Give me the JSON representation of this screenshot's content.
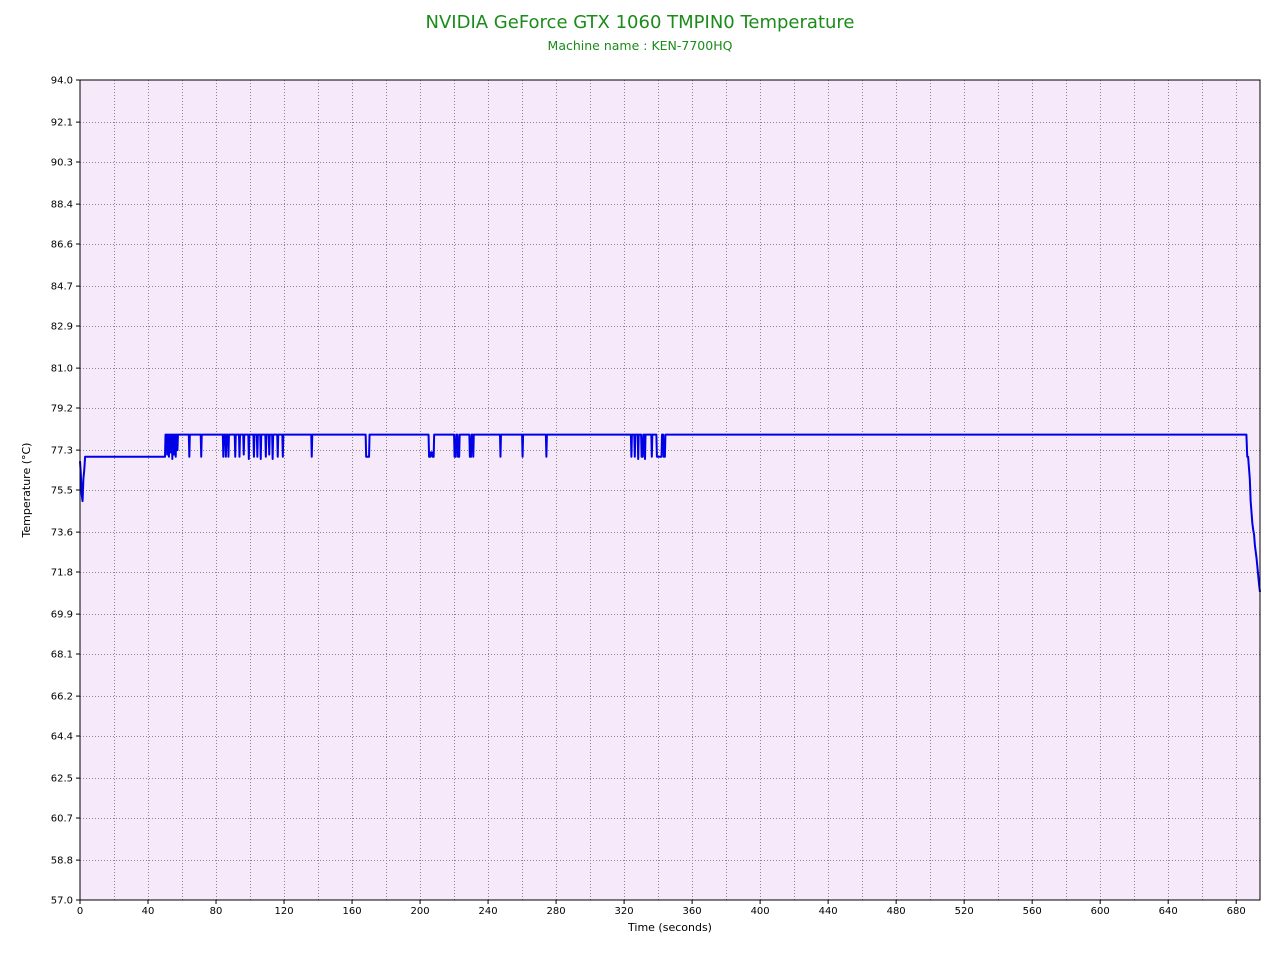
{
  "colors": {
    "title": "#1a8c1a",
    "plot_background": "#f5e9fa",
    "grid": "#888888",
    "series": "#0000e6",
    "frame": "#000000"
  },
  "chart_data": {
    "type": "line",
    "title": "NVIDIA GeForce GTX 1060 TMPIN0 Temperature",
    "subtitle": "Machine name : KEN-7700HQ",
    "xlabel": "Time (seconds)",
    "ylabel": "Temperature (°C)",
    "xlim": [
      0,
      694
    ],
    "ylim": [
      57.0,
      94.0
    ],
    "x_ticks": [
      0,
      40,
      80,
      120,
      160,
      200,
      240,
      280,
      320,
      360,
      400,
      440,
      480,
      520,
      560,
      600,
      640,
      680
    ],
    "x_tick_labels": [
      "0",
      "40",
      "80",
      "120",
      "160",
      "200",
      "240",
      "280",
      "320",
      "360",
      "400",
      "440",
      "480",
      "520",
      "560",
      "600",
      "640",
      "680"
    ],
    "x_minor_grid_step": 20,
    "y_ticks": [
      57.0,
      58.8,
      60.7,
      62.5,
      64.4,
      66.2,
      68.1,
      69.9,
      71.8,
      73.6,
      75.5,
      77.3,
      79.2,
      81.0,
      82.9,
      84.7,
      86.6,
      88.4,
      90.3,
      92.1,
      94.0
    ],
    "y_tick_labels": [
      "57.0",
      "58.8",
      "60.7",
      "62.5",
      "64.4",
      "66.2",
      "68.1",
      "69.9",
      "71.8",
      "73.6",
      "75.5",
      "77.3",
      "79.2",
      "81.0",
      "82.9",
      "84.7",
      "86.6",
      "88.4",
      "90.3",
      "92.1",
      "94.0"
    ],
    "grid": true,
    "series": [
      {
        "color": "#0000e6",
        "points": [
          [
            0,
            76.8
          ],
          [
            0.5,
            76.2
          ],
          [
            1,
            75.3
          ],
          [
            1.5,
            75.0
          ],
          [
            2,
            76.0
          ],
          [
            2.5,
            76.4
          ],
          [
            3,
            77.0
          ],
          [
            50,
            77.0
          ],
          [
            50.3,
            78.0
          ],
          [
            51,
            78.0
          ],
          [
            51.3,
            77.1
          ],
          [
            51.6,
            78.0
          ],
          [
            52,
            78.0
          ],
          [
            52.3,
            77.0
          ],
          [
            52.6,
            78.0
          ],
          [
            53,
            78.0
          ],
          [
            53.3,
            77.2
          ],
          [
            53.6,
            78.0
          ],
          [
            54,
            78.0
          ],
          [
            54.3,
            76.9
          ],
          [
            54.6,
            78.0
          ],
          [
            55,
            78.0
          ],
          [
            55.3,
            77.1
          ],
          [
            55.6,
            78.0
          ],
          [
            56,
            78.0
          ],
          [
            56.3,
            77.0
          ],
          [
            56.6,
            78.0
          ],
          [
            57,
            78.0
          ],
          [
            57.3,
            77.3
          ],
          [
            57.6,
            78.0
          ],
          [
            64,
            78.0
          ],
          [
            64.3,
            77.0
          ],
          [
            64.6,
            78.0
          ],
          [
            71,
            78.0
          ],
          [
            71.3,
            77.0
          ],
          [
            71.6,
            78.0
          ],
          [
            84,
            78.0
          ],
          [
            84.3,
            77.0
          ],
          [
            84.6,
            78.0
          ],
          [
            85.5,
            78.0
          ],
          [
            85.8,
            77.0
          ],
          [
            86.1,
            78.0
          ],
          [
            87,
            78.0
          ],
          [
            87.3,
            77.0
          ],
          [
            87.6,
            78.0
          ],
          [
            91,
            78.0
          ],
          [
            91.3,
            77.0
          ],
          [
            91.6,
            78.0
          ],
          [
            93.5,
            78.0
          ],
          [
            93.8,
            77.0
          ],
          [
            94.1,
            78.0
          ],
          [
            96,
            78.0
          ],
          [
            96.3,
            77.1
          ],
          [
            96.6,
            78.0
          ],
          [
            99,
            78.0
          ],
          [
            99.3,
            76.9
          ],
          [
            99.6,
            78.0
          ],
          [
            102,
            78.0
          ],
          [
            102.3,
            77.0
          ],
          [
            102.6,
            78.0
          ],
          [
            104,
            78.0
          ],
          [
            104.3,
            77.0
          ],
          [
            104.6,
            78.0
          ],
          [
            106,
            78.0
          ],
          [
            106.3,
            76.9
          ],
          [
            106.6,
            78.0
          ],
          [
            109,
            78.0
          ],
          [
            109.3,
            77.0
          ],
          [
            109.6,
            78.0
          ],
          [
            111,
            78.0
          ],
          [
            111.3,
            77.1
          ],
          [
            111.6,
            78.0
          ],
          [
            113,
            78.0
          ],
          [
            113.3,
            76.9
          ],
          [
            113.6,
            78.0
          ],
          [
            116,
            78.0
          ],
          [
            116.3,
            77.0
          ],
          [
            116.6,
            78.0
          ],
          [
            119,
            78.0
          ],
          [
            119.3,
            77.0
          ],
          [
            119.6,
            78.0
          ],
          [
            136,
            78.0
          ],
          [
            136.3,
            77.0
          ],
          [
            136.6,
            78.0
          ],
          [
            168,
            78.0
          ],
          [
            168.3,
            77.0
          ],
          [
            170,
            77.0
          ],
          [
            170.3,
            78.0
          ],
          [
            205,
            78.0
          ],
          [
            205.3,
            77.0
          ],
          [
            206,
            77.0
          ],
          [
            206.3,
            77.2
          ],
          [
            207,
            77.2
          ],
          [
            207.3,
            77.0
          ],
          [
            208,
            77.0
          ],
          [
            208.3,
            78.0
          ],
          [
            220,
            78.0
          ],
          [
            220.3,
            77.0
          ],
          [
            221,
            77.0
          ],
          [
            221.3,
            78.0
          ],
          [
            222,
            78.0
          ],
          [
            222.3,
            77.0
          ],
          [
            223,
            77.0
          ],
          [
            223.3,
            78.0
          ],
          [
            229,
            78.0
          ],
          [
            229.3,
            77.0
          ],
          [
            230,
            77.0
          ],
          [
            230.3,
            78.0
          ],
          [
            231,
            78.0
          ],
          [
            231.3,
            77.0
          ],
          [
            231.6,
            78.0
          ],
          [
            247,
            78.0
          ],
          [
            247.3,
            77.0
          ],
          [
            247.6,
            78.0
          ],
          [
            260,
            78.0
          ],
          [
            260.3,
            77.0
          ],
          [
            260.6,
            78.0
          ],
          [
            274,
            78.0
          ],
          [
            274.3,
            77.0
          ],
          [
            274.6,
            78.0
          ],
          [
            324,
            78.0
          ],
          [
            324.3,
            77.0
          ],
          [
            324.6,
            78.0
          ],
          [
            326,
            78.0
          ],
          [
            326.3,
            77.0
          ],
          [
            326.6,
            78.0
          ],
          [
            328,
            78.0
          ],
          [
            328.3,
            76.9
          ],
          [
            328.6,
            78.0
          ],
          [
            330,
            78.0
          ],
          [
            330.3,
            77.0
          ],
          [
            331,
            77.0
          ],
          [
            331.3,
            78.0
          ],
          [
            332,
            78.0
          ],
          [
            332.3,
            76.9
          ],
          [
            332.6,
            78.0
          ],
          [
            336,
            78.0
          ],
          [
            336.3,
            77.0
          ],
          [
            336.6,
            78.0
          ],
          [
            339,
            78.0
          ],
          [
            339.3,
            77.0
          ],
          [
            342,
            77.0
          ],
          [
            342.3,
            78.0
          ],
          [
            343,
            78.0
          ],
          [
            343.3,
            77.0
          ],
          [
            344,
            77.0
          ],
          [
            344.3,
            78.0
          ],
          [
            686,
            78.0
          ],
          [
            686.5,
            77.0
          ],
          [
            687,
            77.0
          ],
          [
            687.5,
            76.5
          ],
          [
            688,
            76.0
          ],
          [
            688.5,
            75.0
          ],
          [
            689,
            74.5
          ],
          [
            689.5,
            74.0
          ],
          [
            690,
            73.7
          ],
          [
            690.5,
            73.5
          ],
          [
            691,
            73.0
          ],
          [
            691.5,
            72.7
          ],
          [
            692,
            72.4
          ],
          [
            692.5,
            72.0
          ],
          [
            693,
            71.6
          ],
          [
            693.5,
            71.2
          ],
          [
            694,
            70.9
          ]
        ]
      }
    ]
  }
}
